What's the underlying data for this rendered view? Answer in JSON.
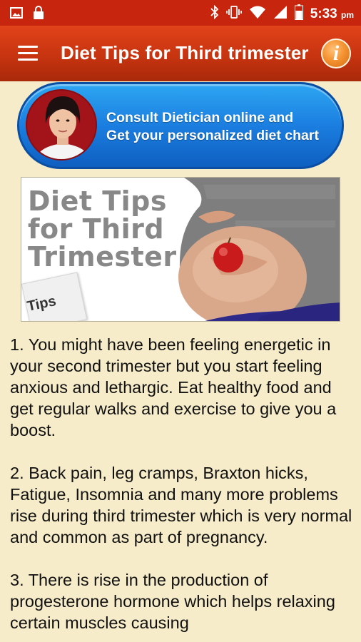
{
  "status_bar": {
    "time": "5:33",
    "ampm": "pm",
    "icons": [
      "image-icon",
      "lock-icon",
      "bluetooth-icon",
      "vibrate-icon",
      "wifi-icon",
      "signal-icon",
      "battery-icon"
    ]
  },
  "app_bar": {
    "title": "Diet Tips for Third trimester",
    "menu_icon": "hamburger-menu-icon",
    "info_icon": "info-icon",
    "info_glyph": "i"
  },
  "consult_banner": {
    "line1": "Consult Dietician online and",
    "line2": "Get your personalized diet chart"
  },
  "hero": {
    "title": "Diet Tips for Third Trimester",
    "tag": "Tips"
  },
  "article": {
    "paragraphs": [
      "1. You might have been feeling energetic in your second trimester but you start feeling anxious and lethargic. Eat healthy food and get regular walks and exercise to give you a boost.",
      "2. Back pain, leg cramps, Braxton hicks, Fatigue, Insomnia and many more problems rise during third trimester which is very normal and common as part of pregnancy.",
      "3. There is rise in the production of progesterone hormone which helps relaxing certain muscles causing"
    ]
  },
  "colors": {
    "status_bar": "#c8250f",
    "app_bar": "#c73410",
    "background": "#f6ecc9",
    "banner_blue": "#1b7ee0"
  }
}
